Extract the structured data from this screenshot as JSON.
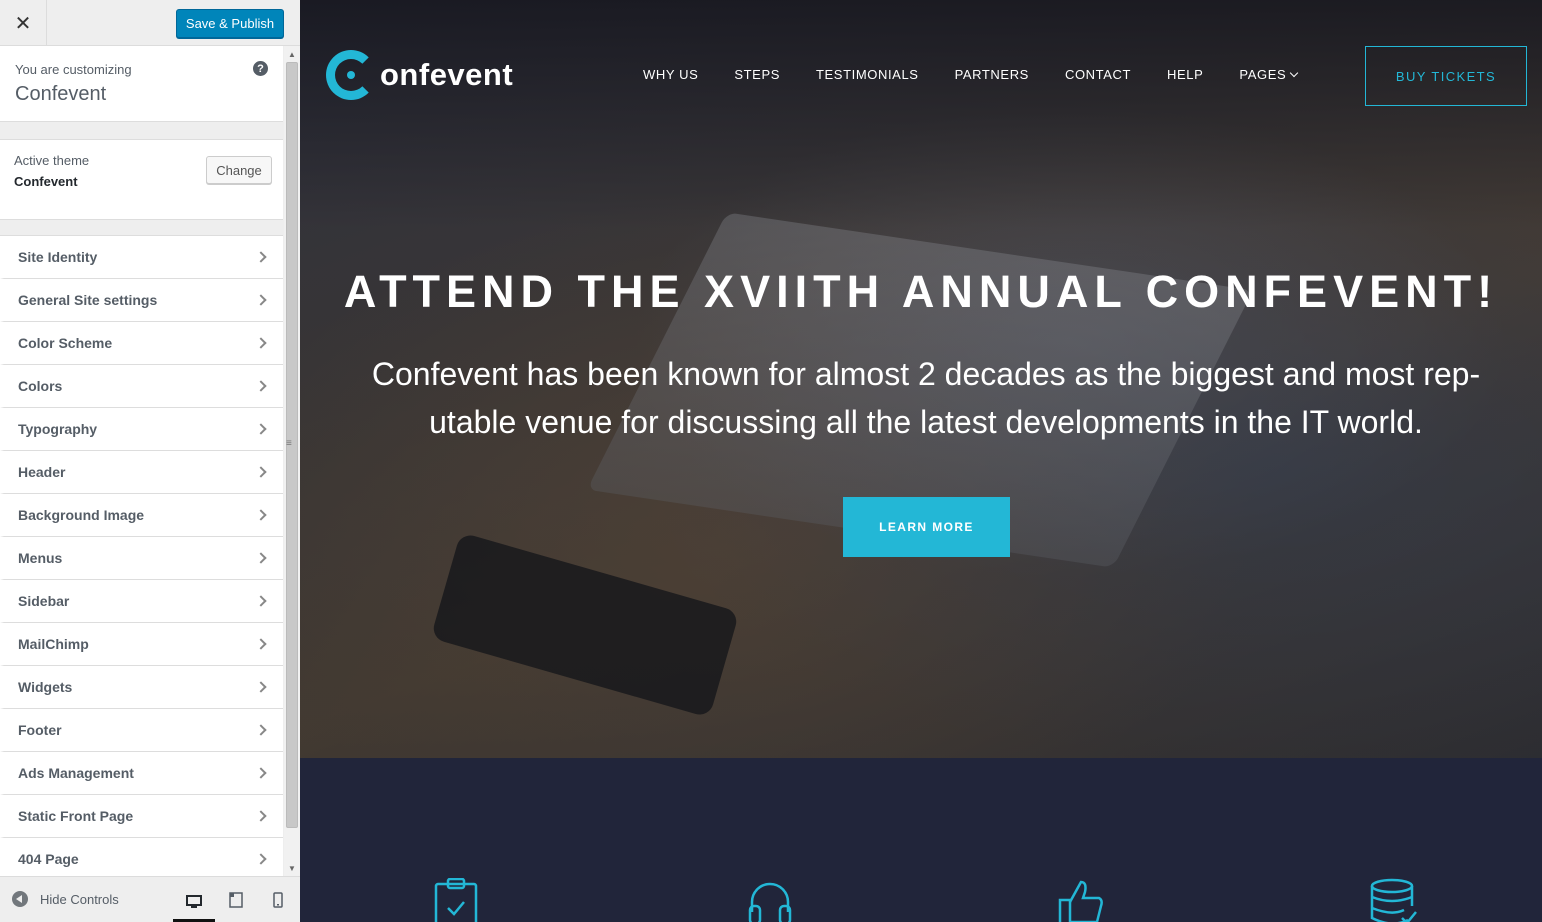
{
  "sidebar": {
    "close_symbol": "✕",
    "save_label": "Save & Publish",
    "customizing_pre": "You are customizing",
    "customizing_title": "Confevent",
    "help_symbol": "?",
    "active_theme_pre": "Active theme",
    "active_theme_name": "Confevent",
    "change_label": "Change",
    "items": [
      {
        "label": "Site Identity"
      },
      {
        "label": "General Site settings"
      },
      {
        "label": "Color Scheme"
      },
      {
        "label": "Colors"
      },
      {
        "label": "Typography"
      },
      {
        "label": "Header"
      },
      {
        "label": "Background Image"
      },
      {
        "label": "Menus"
      },
      {
        "label": "Sidebar"
      },
      {
        "label": "MailChimp"
      },
      {
        "label": "Widgets"
      },
      {
        "label": "Footer"
      },
      {
        "label": "Ads Management"
      },
      {
        "label": "Static Front Page"
      },
      {
        "label": "404 Page"
      }
    ],
    "hide_controls_label": "Hide Controls",
    "devices": [
      "desktop-icon",
      "tablet-icon",
      "mobile-icon"
    ]
  },
  "site": {
    "logo_text": "onfevent",
    "nav": [
      "WHY US",
      "STEPS",
      "TESTIMONIALS",
      "PARTNERS",
      "CONTACT",
      "HELP",
      "PAGES"
    ],
    "buy_tickets": "BUY TICKETS",
    "hero_title": "ATTEND THE XVIITH ANNUAL CONFEVENT!",
    "hero_sub_line1": "Confevent has been known for almost 2 decades as the biggest and most rep-",
    "hero_sub_line2": "utable venue for discussing all the latest developments in the IT world.",
    "learn_more": "LEARN MORE",
    "feature_icons": [
      "clipboard-check-icon",
      "headset-icon",
      "thumbs-up-icon",
      "database-check-icon"
    ]
  },
  "colors": {
    "accent": "#23b7d6",
    "wp_primary": "#0085ba",
    "features_bg": "#21253a"
  }
}
